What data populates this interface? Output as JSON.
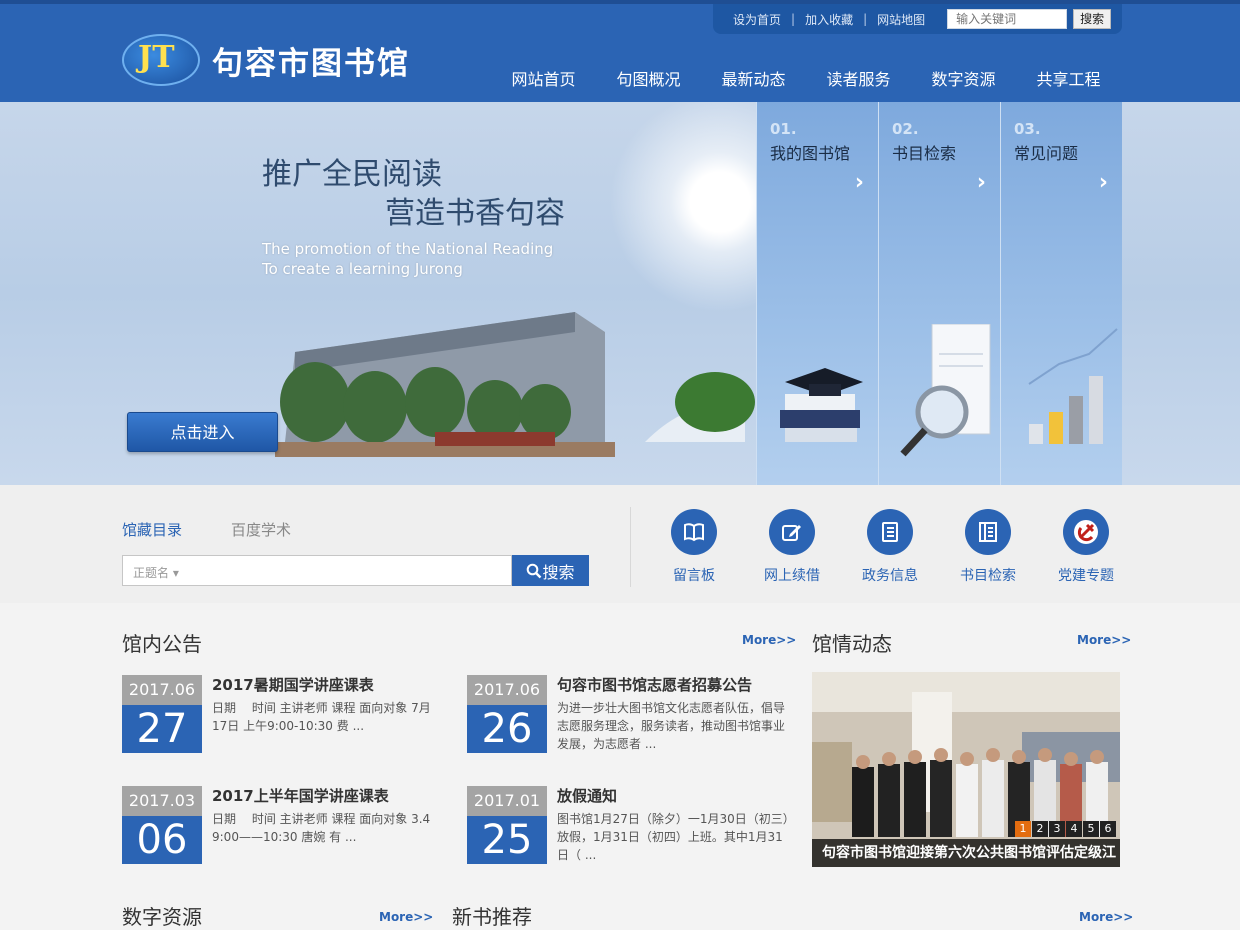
{
  "header": {
    "toplinks": [
      "设为首页",
      "加入收藏",
      "网站地图"
    ],
    "search_placeholder": "输入关键词",
    "search_button": "搜索",
    "logo_mark": "JT",
    "site_name": "句容市图书馆",
    "nav": [
      "网站首页",
      "句图概况",
      "最新动态",
      "读者服务",
      "数字资源",
      "共享工程"
    ]
  },
  "banner": {
    "slogan_line1": "推广全民阅读",
    "slogan_line2": "营造书香句容",
    "english_line1": "The promotion of the National Reading",
    "english_line2": "To create a learning Jurong",
    "enter_button": "点击进入",
    "cards": [
      {
        "num": "01.",
        "title": "我的图书馆"
      },
      {
        "num": "02.",
        "title": "书目检索"
      },
      {
        "num": "03.",
        "title": "常见问题"
      }
    ]
  },
  "search": {
    "tabs": [
      "馆藏目录",
      "百度学术"
    ],
    "field_placeholder": "正题名",
    "button": "搜索",
    "quick_links": [
      "留言板",
      "网上续借",
      "政务信息",
      "书目检索",
      "党建专题"
    ]
  },
  "notices": {
    "title": "馆内公告",
    "more": "More>>",
    "items": [
      {
        "ym": "2017.06",
        "day": "27",
        "title": "2017暑期国学讲座课表",
        "desc": "日期　 时间 主讲老师 课程 面向对象 7月17日 上午9:00-10:30 费 ..."
      },
      {
        "ym": "2017.06",
        "day": "26",
        "title": "句容市图书馆志愿者招募公告",
        "desc": "为进一步壮大图书馆文化志愿者队伍，倡导志愿服务理念，服务读者，推动图书馆事业发展，为志愿者 ..."
      },
      {
        "ym": "2017.03",
        "day": "06",
        "title": "2017上半年国学讲座课表",
        "desc": "日期　 时间 主讲老师 课程 面向对象 3.4 9:00——10:30 唐婉 有 ..."
      },
      {
        "ym": "2017.01",
        "day": "25",
        "title": "放假通知",
        "desc": "图书馆1月27日（除夕）一1月30日（初三）放假，1月31日（初四）上班。其中1月31日（ ..."
      }
    ]
  },
  "news": {
    "title": "馆情动态",
    "more": "More>>",
    "caption": "句容市图书馆迎接第六次公共图书馆评估定级江",
    "pager": [
      "1",
      "2",
      "3",
      "4",
      "5",
      "6"
    ]
  },
  "bottom": {
    "digital_title": "数字资源",
    "digital_more": "More>>",
    "newbook_title": "新书推荐",
    "newbook_more": "More>>"
  }
}
